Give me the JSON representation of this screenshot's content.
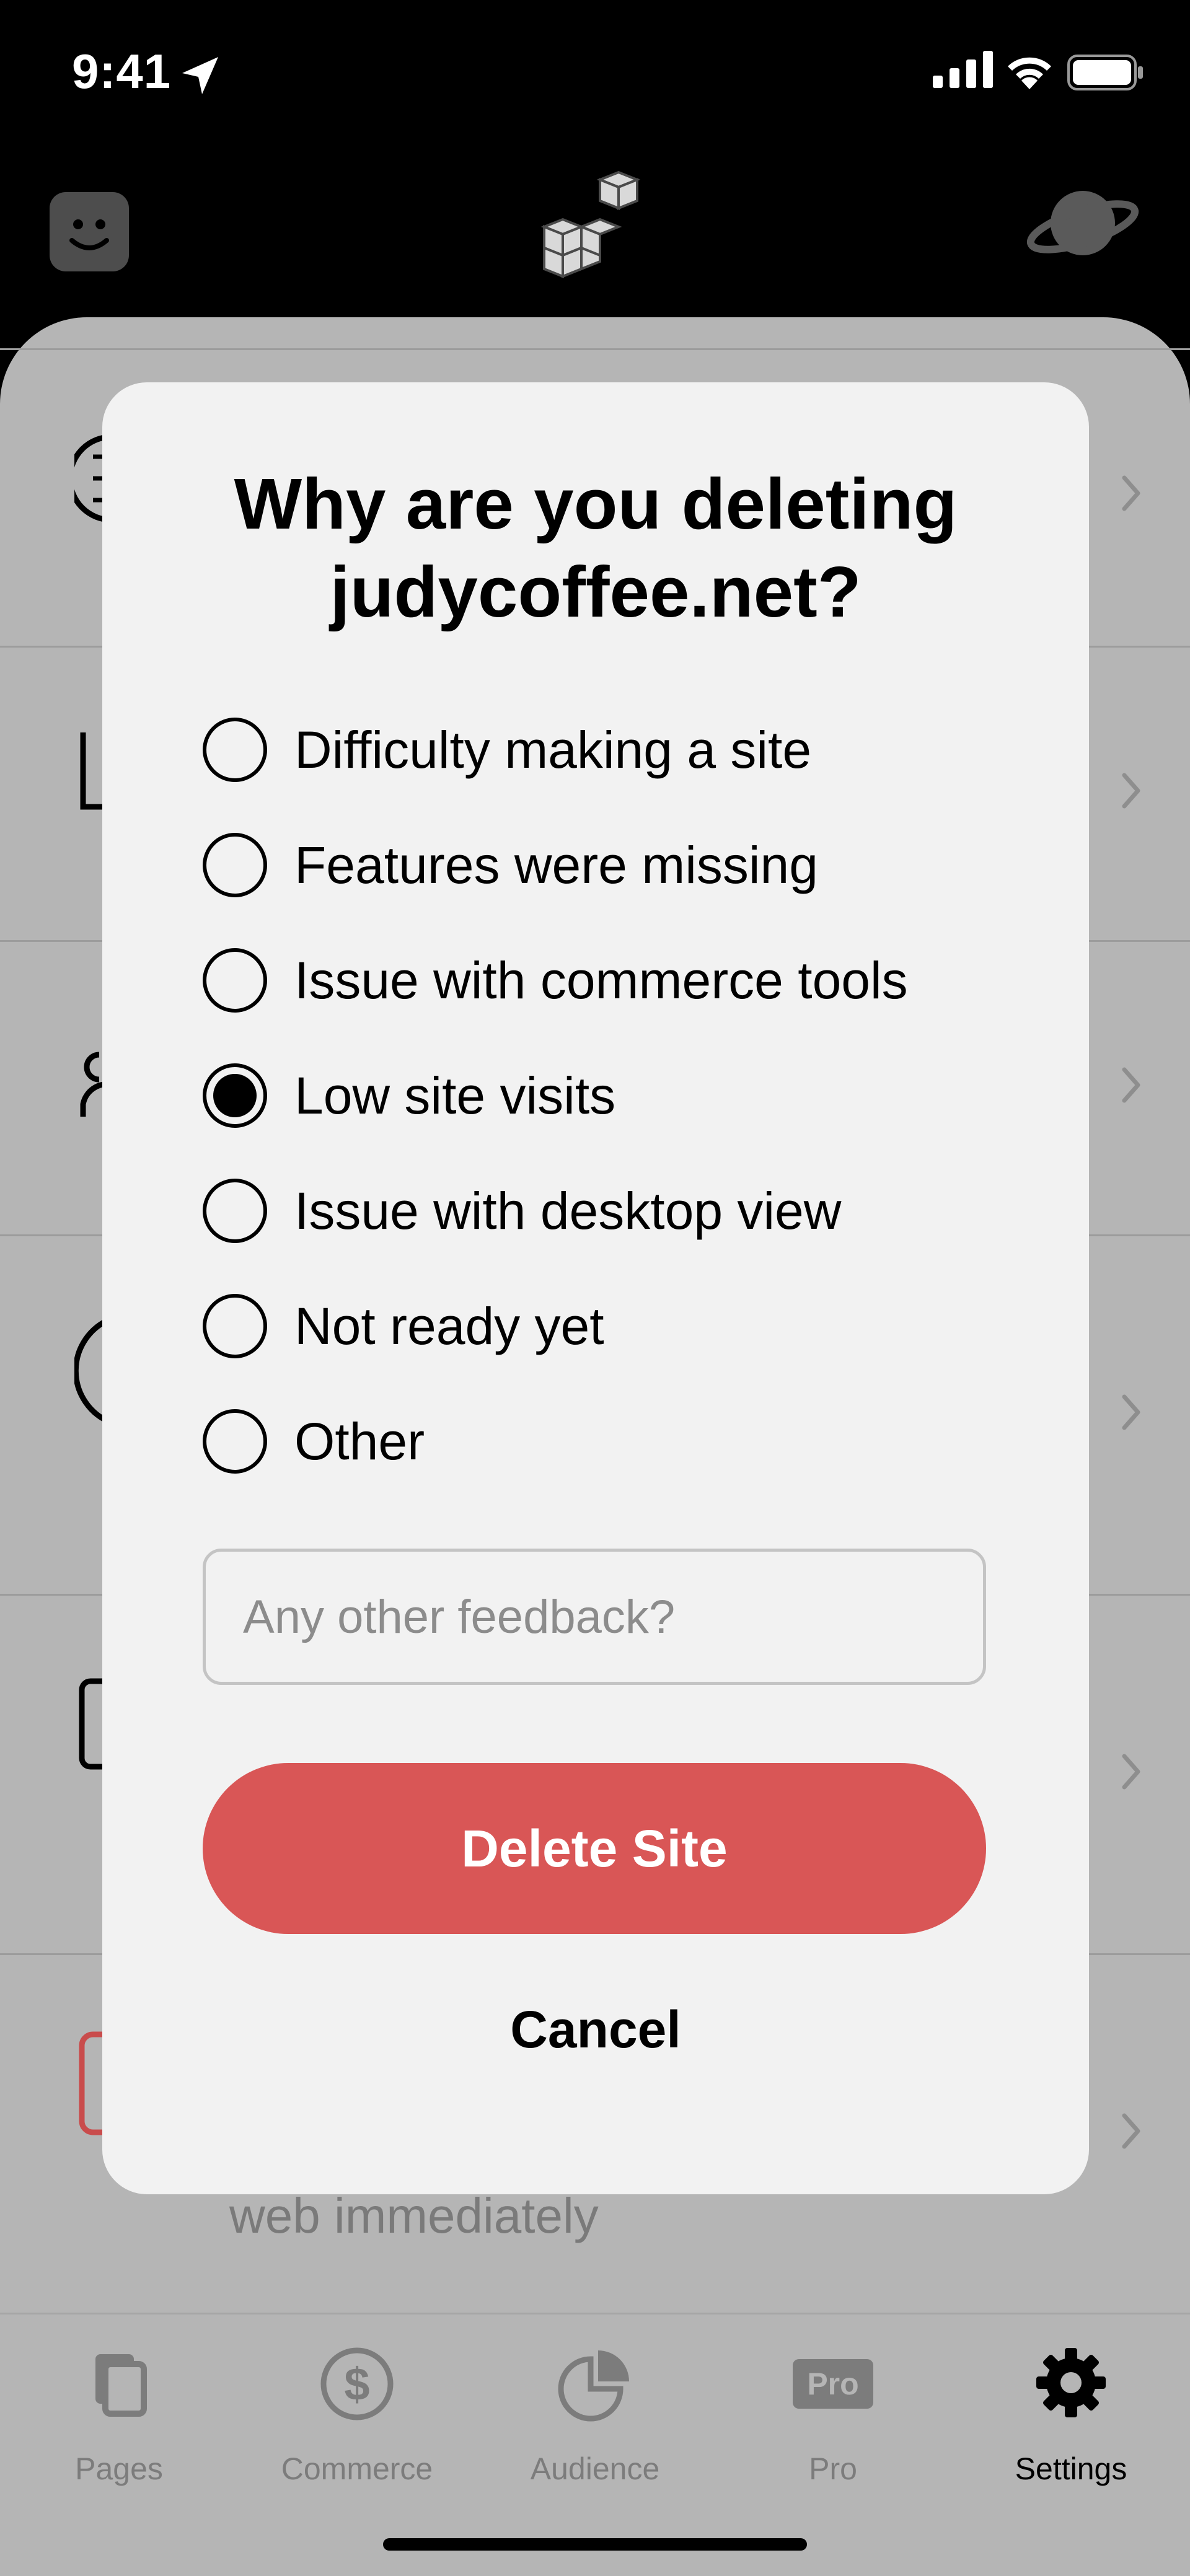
{
  "status_bar": {
    "time": "9:41"
  },
  "dialog": {
    "title_line1": "Why are you deleting",
    "title_line2": "judycoffee.net?",
    "options": [
      {
        "label": "Difficulty making a site",
        "selected": false
      },
      {
        "label": "Features were missing",
        "selected": false
      },
      {
        "label": "Issue with commerce tools",
        "selected": false
      },
      {
        "label": "Low site visits",
        "selected": true
      },
      {
        "label": "Issue with desktop view",
        "selected": false
      },
      {
        "label": "Not ready yet",
        "selected": false
      },
      {
        "label": "Other",
        "selected": false
      }
    ],
    "feedback_placeholder": "Any other feedback?",
    "feedback_value": "",
    "delete_label": "Delete Site",
    "cancel_label": "Cancel"
  },
  "background": {
    "partial_subtitle": "web immediately"
  },
  "tabs": [
    {
      "label": "Pages",
      "icon": "pages-icon",
      "active": false
    },
    {
      "label": "Commerce",
      "icon": "commerce-icon",
      "active": false
    },
    {
      "label": "Audience",
      "icon": "audience-icon",
      "active": false
    },
    {
      "label": "Pro",
      "icon": "pro-icon",
      "active": false,
      "badge": "Pro"
    },
    {
      "label": "Settings",
      "icon": "settings-icon",
      "active": true
    }
  ],
  "colors": {
    "delete_button": "#d95656",
    "modal_background": "#f2f2f2",
    "dimmed_background": "#b5b5b5"
  }
}
